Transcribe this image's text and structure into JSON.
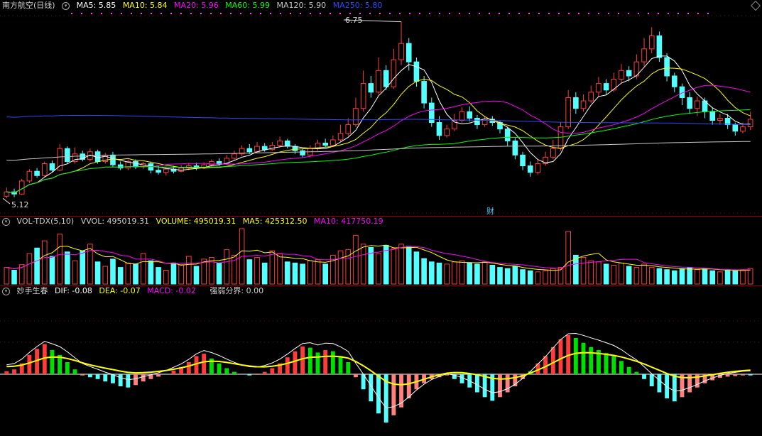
{
  "colors": {
    "up": "#ff3c3c",
    "down": "#54ffff",
    "ma5": "#ffffff",
    "ma10": "#ffff00",
    "ma20": "#ff00ff",
    "ma60": "#00ff00",
    "ma120": "#c8c8c8",
    "ma250": "#2b4bff",
    "dif": "#ffffff",
    "dea": "#ffff00",
    "macd_up": "#ff3c3c",
    "macd_down": "#54ffff",
    "grid": "#8b0000"
  },
  "main": {
    "title": "南方航空(日线)",
    "ma5": "MA5: 5.85",
    "ma10": "MA10: 5.84",
    "ma20": "MA20: 5.96",
    "ma60": "MA60: 5.99",
    "ma120": "MA120: 5.90",
    "ma250": "MA250: 5.80",
    "high_label": "6.75",
    "low_label": "5.12",
    "event_label": "财"
  },
  "volume": {
    "title": "VOL-TDX(5,10)",
    "vvol": "VVOL: 495019.31",
    "volume": "VOLUME: 495019.31",
    "ma5": "MA5: 425312.50",
    "ma10": "MA10: 417750.19"
  },
  "macd": {
    "title": "妙手生春",
    "dif": "DIF: -0.08",
    "dea": "DEA: -0.07",
    "macd": "MACD: -0.02",
    "divider": "强弱分界: 0.00"
  },
  "chart_data": [
    {
      "type": "candlestick",
      "y_range": [
        5.12,
        6.75
      ],
      "candles": [
        [
          5.14,
          5.18,
          5.22,
          5.12
        ],
        [
          5.18,
          5.16,
          5.21,
          5.13
        ],
        [
          5.16,
          5.28,
          5.3,
          5.15
        ],
        [
          5.28,
          5.37,
          5.39,
          5.26
        ],
        [
          5.37,
          5.33,
          5.4,
          5.31
        ],
        [
          5.33,
          5.44,
          5.46,
          5.32
        ],
        [
          5.44,
          5.38,
          5.47,
          5.36
        ],
        [
          5.38,
          5.58,
          5.62,
          5.37
        ],
        [
          5.58,
          5.46,
          5.6,
          5.44
        ],
        [
          5.46,
          5.53,
          5.59,
          5.44
        ],
        [
          5.53,
          5.48,
          5.56,
          5.46
        ],
        [
          5.48,
          5.55,
          5.58,
          5.46
        ],
        [
          5.55,
          5.46,
          5.57,
          5.44
        ],
        [
          5.46,
          5.52,
          5.54,
          5.44
        ],
        [
          5.52,
          5.43,
          5.55,
          5.41
        ],
        [
          5.43,
          5.4,
          5.46,
          5.38
        ],
        [
          5.4,
          5.46,
          5.48,
          5.38
        ],
        [
          5.46,
          5.41,
          5.48,
          5.39
        ],
        [
          5.41,
          5.44,
          5.46,
          5.39
        ],
        [
          5.44,
          5.38,
          5.46,
          5.35
        ],
        [
          5.38,
          5.36,
          5.42,
          5.34
        ],
        [
          5.36,
          5.39,
          5.41,
          5.33
        ],
        [
          5.39,
          5.37,
          5.42,
          5.35
        ],
        [
          5.37,
          5.4,
          5.43,
          5.36
        ],
        [
          5.4,
          5.42,
          5.44,
          5.38
        ],
        [
          5.42,
          5.4,
          5.45,
          5.38
        ],
        [
          5.4,
          5.43,
          5.45,
          5.39
        ],
        [
          5.43,
          5.46,
          5.48,
          5.41
        ],
        [
          5.46,
          5.44,
          5.49,
          5.42
        ],
        [
          5.44,
          5.49,
          5.52,
          5.43
        ],
        [
          5.49,
          5.53,
          5.56,
          5.47
        ],
        [
          5.53,
          5.58,
          5.61,
          5.51
        ],
        [
          5.58,
          5.55,
          5.62,
          5.53
        ],
        [
          5.55,
          5.6,
          5.64,
          5.54
        ],
        [
          5.6,
          5.57,
          5.63,
          5.55
        ],
        [
          5.57,
          5.61,
          5.64,
          5.56
        ],
        [
          5.61,
          5.65,
          5.69,
          5.59
        ],
        [
          5.65,
          5.6,
          5.67,
          5.58
        ],
        [
          5.6,
          5.56,
          5.62,
          5.53
        ],
        [
          5.56,
          5.52,
          5.58,
          5.5
        ],
        [
          5.52,
          5.58,
          5.61,
          5.51
        ],
        [
          5.58,
          5.63,
          5.66,
          5.56
        ],
        [
          5.63,
          5.61,
          5.67,
          5.59
        ],
        [
          5.61,
          5.66,
          5.7,
          5.6
        ],
        [
          5.66,
          5.72,
          5.8,
          5.64
        ],
        [
          5.72,
          5.8,
          5.86,
          5.7
        ],
        [
          5.8,
          5.95,
          6.05,
          5.78
        ],
        [
          5.95,
          6.18,
          6.3,
          5.92
        ],
        [
          6.18,
          6.1,
          6.25,
          6.05
        ],
        [
          6.1,
          6.3,
          6.42,
          6.08
        ],
        [
          6.3,
          6.15,
          6.35,
          6.12
        ],
        [
          6.15,
          6.4,
          6.5,
          6.13
        ],
        [
          6.4,
          6.55,
          6.75,
          6.35
        ],
        [
          6.55,
          6.38,
          6.6,
          6.3
        ],
        [
          6.38,
          6.2,
          6.42,
          6.15
        ],
        [
          6.2,
          6.0,
          6.25,
          5.95
        ],
        [
          6.0,
          5.82,
          6.05,
          5.78
        ],
        [
          5.82,
          5.7,
          5.88,
          5.66
        ],
        [
          5.7,
          5.76,
          5.8,
          5.68
        ],
        [
          5.76,
          5.84,
          5.9,
          5.74
        ],
        [
          5.84,
          5.92,
          5.96,
          5.82
        ],
        [
          5.92,
          5.86,
          5.97,
          5.83
        ],
        [
          5.86,
          5.8,
          5.89,
          5.76
        ],
        [
          5.8,
          5.85,
          5.88,
          5.78
        ],
        [
          5.85,
          5.82,
          5.88,
          5.79
        ],
        [
          5.82,
          5.76,
          5.84,
          5.72
        ],
        [
          5.76,
          5.65,
          5.78,
          5.6
        ],
        [
          5.65,
          5.52,
          5.68,
          5.48
        ],
        [
          5.52,
          5.42,
          5.55,
          5.38
        ],
        [
          5.42,
          5.36,
          5.46,
          5.32
        ],
        [
          5.36,
          5.44,
          5.48,
          5.34
        ],
        [
          5.44,
          5.5,
          5.55,
          5.42
        ],
        [
          5.5,
          5.58,
          5.66,
          5.48
        ],
        [
          5.58,
          5.78,
          5.82,
          5.56
        ],
        [
          5.78,
          6.05,
          6.12,
          5.76
        ],
        [
          6.05,
          5.95,
          6.1,
          5.9
        ],
        [
          5.95,
          6.02,
          6.08,
          5.92
        ],
        [
          6.02,
          6.1,
          6.16,
          6.0
        ],
        [
          6.1,
          6.18,
          6.24,
          6.06
        ],
        [
          6.18,
          6.12,
          6.22,
          6.08
        ],
        [
          6.12,
          6.22,
          6.28,
          6.1
        ],
        [
          6.22,
          6.3,
          6.36,
          6.18
        ],
        [
          6.3,
          6.25,
          6.34,
          6.2
        ],
        [
          6.25,
          6.38,
          6.45,
          6.22
        ],
        [
          6.38,
          6.5,
          6.6,
          6.34
        ],
        [
          6.5,
          6.62,
          6.7,
          6.46
        ],
        [
          6.62,
          6.42,
          6.66,
          6.38
        ],
        [
          6.42,
          6.25,
          6.46,
          6.2
        ],
        [
          6.25,
          6.15,
          6.28,
          6.1
        ],
        [
          6.15,
          6.05,
          6.18,
          5.98
        ],
        [
          6.05,
          5.95,
          6.1,
          5.9
        ],
        [
          5.95,
          6.02,
          6.06,
          5.88
        ],
        [
          6.02,
          5.92,
          6.05,
          5.86
        ],
        [
          5.92,
          5.84,
          5.96,
          5.8
        ],
        [
          5.84,
          5.86,
          5.9,
          5.8
        ],
        [
          5.86,
          5.8,
          5.9,
          5.76
        ],
        [
          5.8,
          5.74,
          5.82,
          5.7
        ],
        [
          5.74,
          5.78,
          5.82,
          5.72
        ],
        [
          5.78,
          5.85,
          5.92,
          5.75
        ]
      ]
    },
    {
      "type": "bar",
      "name": "VOLUME",
      "values": [
        0.3,
        0.25,
        0.35,
        0.55,
        0.65,
        0.78,
        0.5,
        0.9,
        0.58,
        0.42,
        0.6,
        0.72,
        0.4,
        0.32,
        0.45,
        0.3,
        0.38,
        0.36,
        0.55,
        0.42,
        0.3,
        0.25,
        0.38,
        0.35,
        0.5,
        0.32,
        0.45,
        0.48,
        0.38,
        0.62,
        0.52,
        1.0,
        0.44,
        0.48,
        0.38,
        0.6,
        0.55,
        0.4,
        0.38,
        0.36,
        0.42,
        0.44,
        0.36,
        0.52,
        0.6,
        0.62,
        0.88,
        0.72,
        0.66,
        0.55,
        0.7,
        0.64,
        0.72,
        0.68,
        0.58,
        0.46,
        0.4,
        0.38,
        0.36,
        0.4,
        0.42,
        0.38,
        0.36,
        0.4,
        0.34,
        0.3,
        0.28,
        0.32,
        0.26,
        0.24,
        0.22,
        0.24,
        0.28,
        0.3,
        0.95,
        0.52,
        0.48,
        0.42,
        0.4,
        0.36,
        0.34,
        0.38,
        0.32,
        0.3,
        0.36,
        0.3,
        0.28,
        0.26,
        0.24,
        0.28,
        0.3,
        0.26,
        0.28,
        0.24,
        0.22,
        0.26,
        0.24,
        0.26,
        0.28
      ]
    },
    {
      "type": "bar",
      "name": "MACD",
      "values": [
        0.05,
        0.08,
        0.18,
        0.32,
        0.42,
        0.5,
        0.4,
        0.32,
        0.2,
        0.08,
        -0.02,
        -0.05,
        -0.08,
        -0.12,
        -0.15,
        -0.2,
        -0.22,
        -0.18,
        -0.12,
        -0.08,
        -0.04,
        0.0,
        0.06,
        0.12,
        0.2,
        0.3,
        0.34,
        0.26,
        0.18,
        0.1,
        0.04,
        0.0,
        -0.02,
        -0.01,
        0.04,
        0.1,
        0.18,
        0.28,
        0.38,
        0.46,
        0.44,
        0.36,
        0.4,
        0.38,
        0.3,
        0.2,
        -0.05,
        -0.25,
        -0.45,
        -0.65,
        -0.8,
        -0.68,
        -0.55,
        -0.4,
        -0.25,
        -0.15,
        -0.08,
        -0.05,
        -0.02,
        -0.08,
        -0.15,
        -0.22,
        -0.3,
        -0.38,
        -0.44,
        -0.38,
        -0.3,
        -0.2,
        -0.08,
        0.05,
        0.18,
        0.3,
        0.45,
        0.58,
        0.65,
        0.6,
        0.52,
        0.45,
        0.4,
        0.35,
        0.3,
        0.22,
        0.12,
        0.04,
        -0.08,
        -0.2,
        -0.3,
        -0.4,
        -0.45,
        -0.38,
        -0.3,
        -0.22,
        -0.15,
        -0.1,
        -0.06,
        -0.04,
        -0.03,
        -0.02,
        -0.02
      ]
    }
  ]
}
